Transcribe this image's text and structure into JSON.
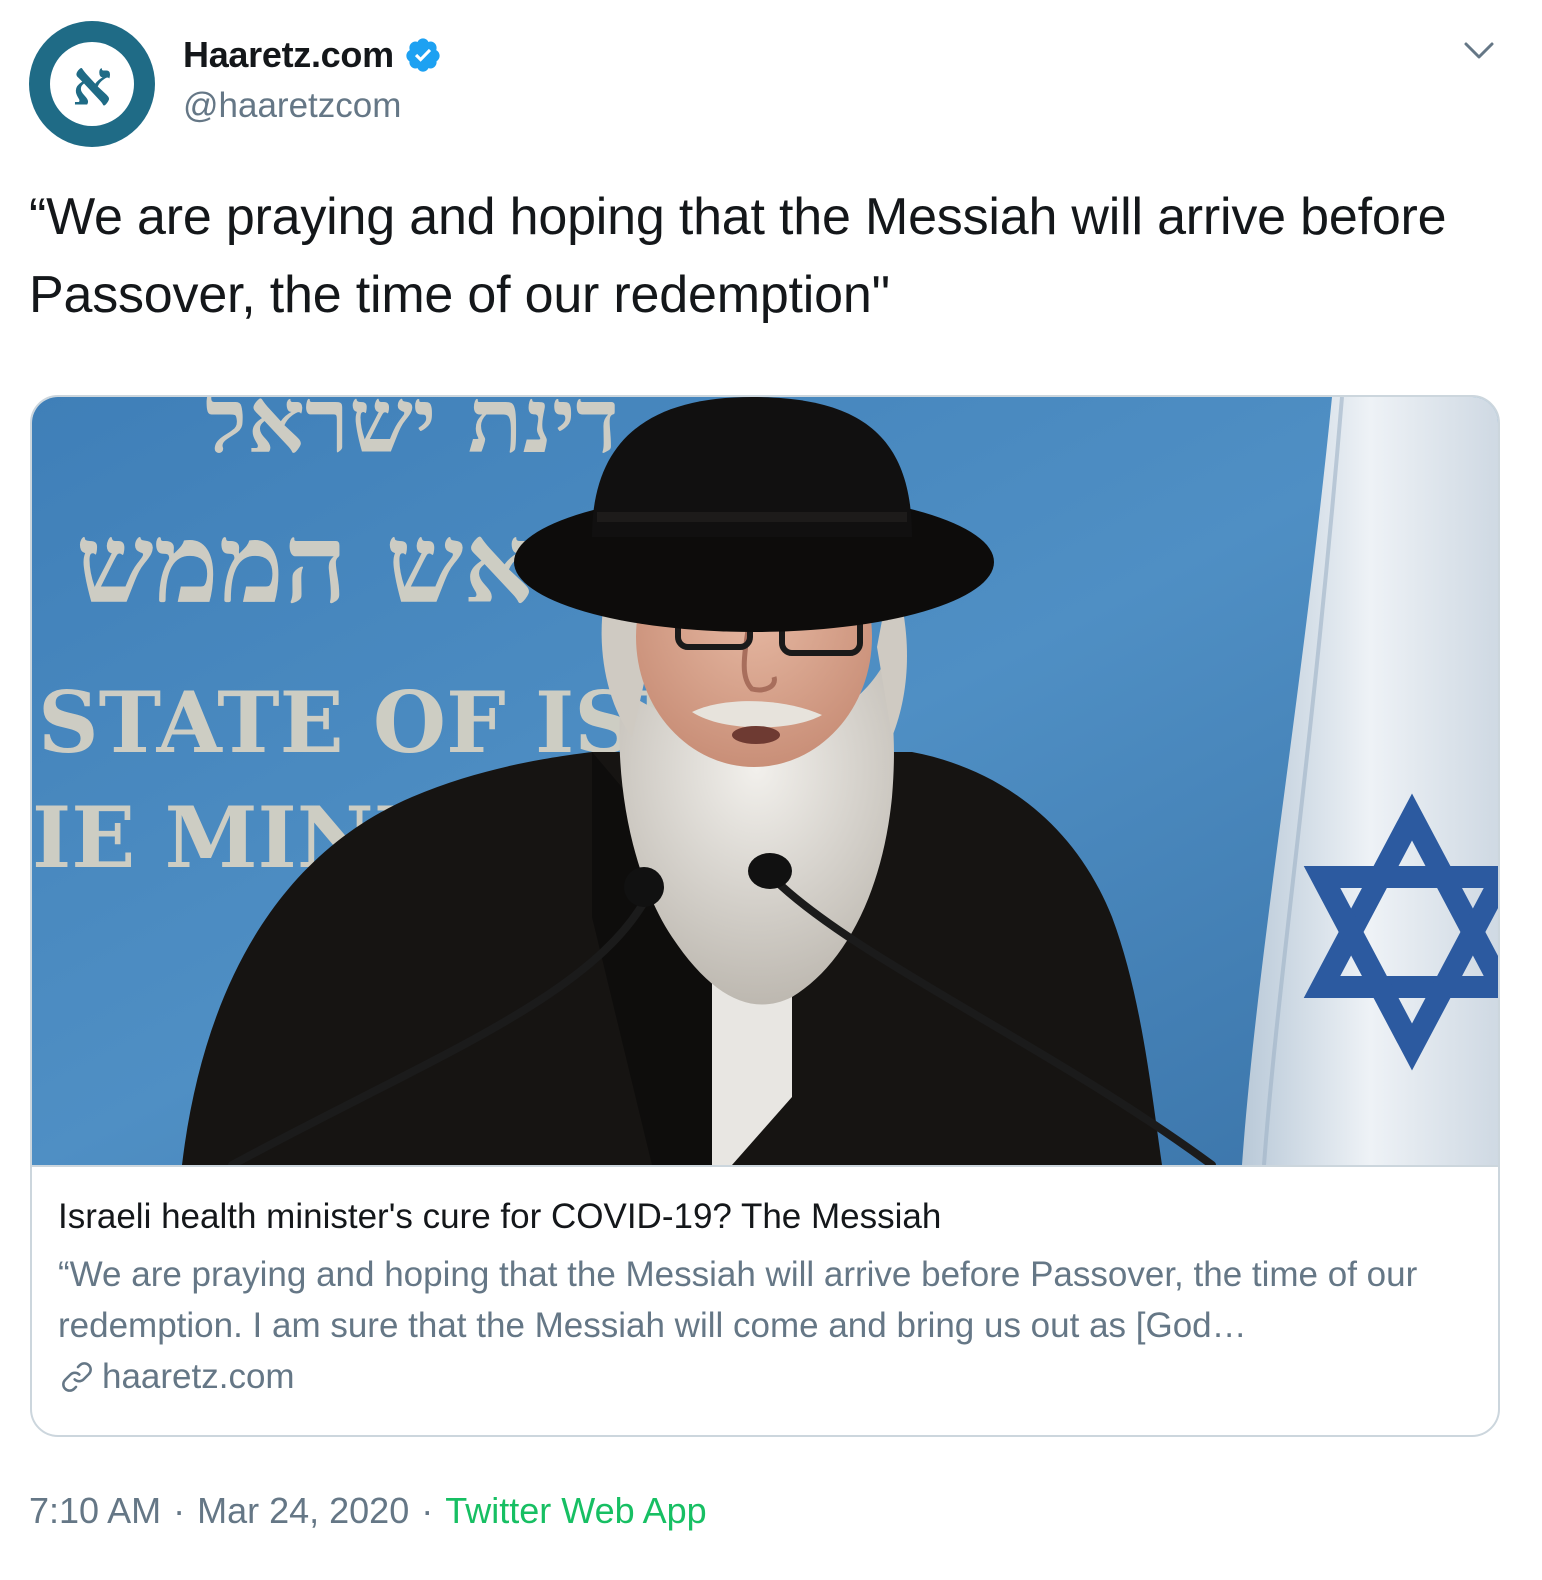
{
  "author": {
    "display_name": "Haaretz.com",
    "handle": "@haaretzcom",
    "avatar_glyph": "א",
    "verified": true
  },
  "tweet": {
    "text": "“We are praying and hoping that the Messiah will arrive before Passover, the time of our redemption\""
  },
  "card": {
    "image_text": {
      "hebrew_line1": "דינת ישראל",
      "hebrew_line2": "ראש הממש",
      "english_line1": "STATE OF ISR",
      "english_line2": "IE MINIS"
    },
    "title": "Israeli health minister's cure for COVID-19? The Messiah",
    "description": "“We are praying and hoping that the Messiah will arrive before Passover, the time of our redemption. I am sure that the Messiah will come and bring us out as [God…",
    "domain": "haaretz.com"
  },
  "meta": {
    "time": "7:10 AM",
    "separator": "·",
    "date": "Mar 24, 2020",
    "source": "Twitter Web App"
  },
  "colors": {
    "text_primary": "#14171a",
    "text_secondary": "#657786",
    "verified_blue": "#1da1f2",
    "source_green": "#17bf63",
    "border": "#ccd6dd",
    "avatar_bg": "#1f6b86"
  },
  "icons": [
    "avatar-logo",
    "verified-badge-icon",
    "chevron-down-icon",
    "link-icon"
  ]
}
